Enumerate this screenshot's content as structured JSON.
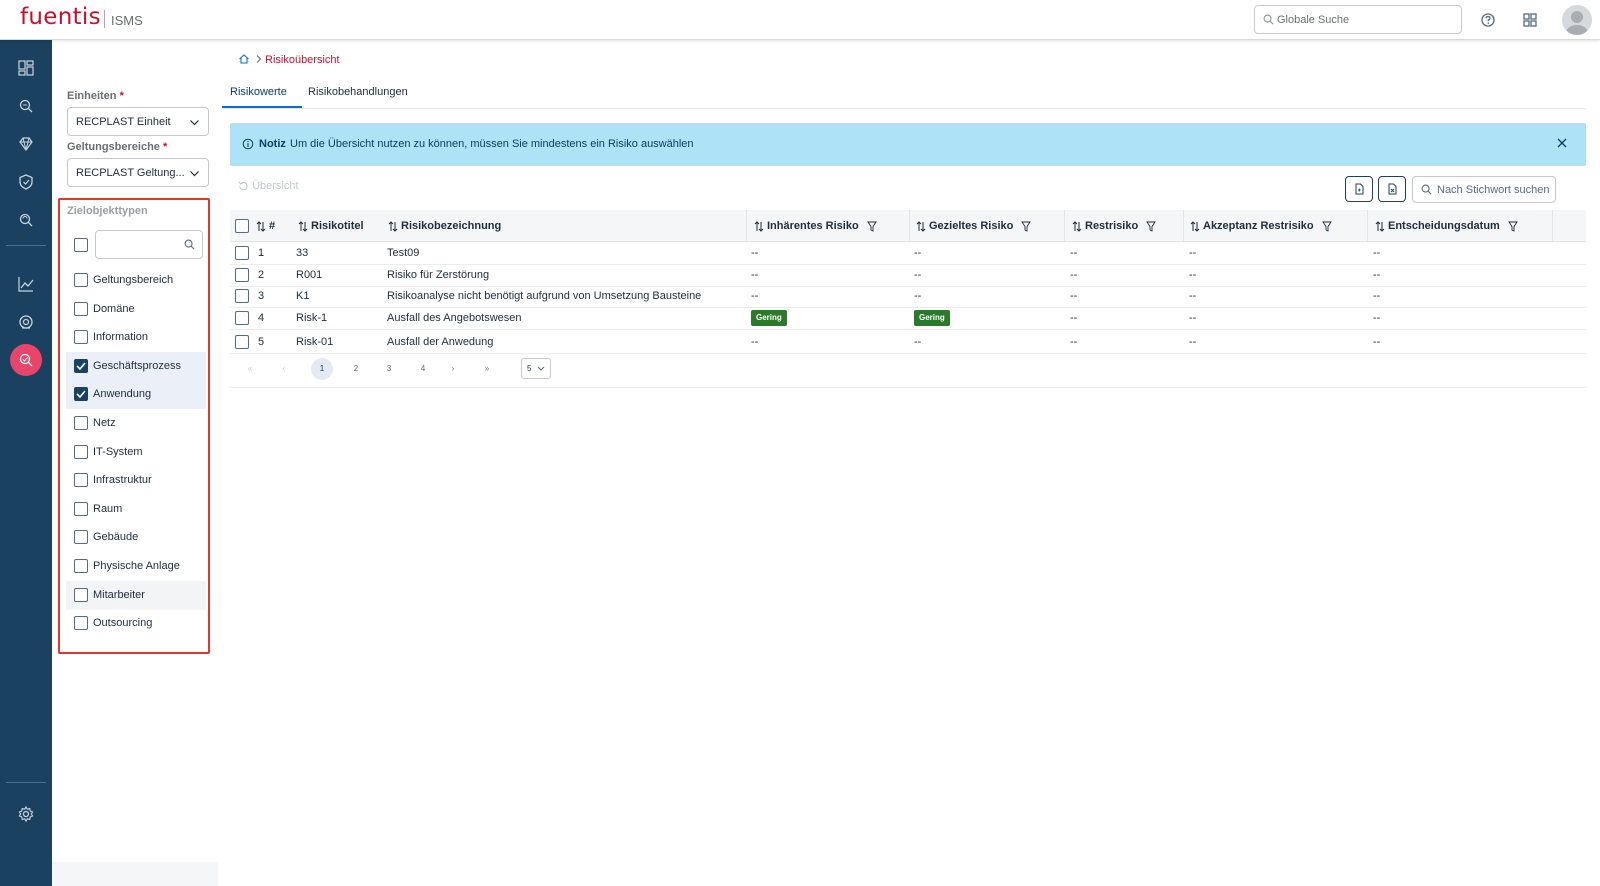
{
  "app": {
    "brand": "fuentis",
    "module": "ISMS"
  },
  "header": {
    "search_placeholder": "Globale Suche"
  },
  "nav": {
    "items": [
      "dashboard-icon",
      "search-risk-icon",
      "diamond-icon",
      "shield-icon",
      "search-refresh-icon",
      "chart-icon",
      "target-icon",
      "risk-active-icon",
      "settings-icon"
    ]
  },
  "breadcrumb": {
    "current": "Risikoübersicht"
  },
  "filters": {
    "einheiten_label": "Einheiten",
    "einheiten_value": "RECPLAST Einheit",
    "geltungsbereiche_label": "Geltungsbereiche",
    "geltungsbereiche_value": "RECPLAST Geltung...",
    "required_mark": "*",
    "zielobjekttypen_label": "Zielobjekttypen",
    "items": [
      {
        "label": "Geltungsbereich",
        "checked": false
      },
      {
        "label": "Domäne",
        "checked": false
      },
      {
        "label": "Information",
        "checked": false
      },
      {
        "label": "Geschäftsprozess",
        "checked": true
      },
      {
        "label": "Anwendung",
        "checked": true
      },
      {
        "label": "Netz",
        "checked": false
      },
      {
        "label": "IT-System",
        "checked": false
      },
      {
        "label": "Infrastruktur",
        "checked": false
      },
      {
        "label": "Raum",
        "checked": false
      },
      {
        "label": "Gebäude",
        "checked": false
      },
      {
        "label": "Physische Anlage",
        "checked": false
      },
      {
        "label": "Mitarbeiter",
        "checked": false
      },
      {
        "label": "Outsourcing",
        "checked": false
      }
    ]
  },
  "tabs": [
    {
      "label": "Risikowerte",
      "active": true
    },
    {
      "label": "Risikobehandlungen",
      "active": false
    }
  ],
  "notice": {
    "title": "Notiz",
    "text": "Um die Übersicht nutzen zu können, müssen Sie mindestens ein Risiko auswählen"
  },
  "toolbar": {
    "reset_label": "Übersicht",
    "search_placeholder": "Nach Stichwort suchen"
  },
  "table": {
    "headers": [
      "#",
      "Risikotitel",
      "Risikobezeichnung",
      "Inhärentes Risiko",
      "Gezieltes Risiko",
      "Restrisiko",
      "Akzeptanz Restrisiko",
      "Entscheidungsdatum"
    ],
    "rows": [
      {
        "num": "1",
        "titel": "33",
        "bez": "Test09",
        "inh": "--",
        "gez": "--",
        "rest": "--",
        "akz": "--",
        "datum": "--"
      },
      {
        "num": "2",
        "titel": "R001",
        "bez": "Risiko für Zerstörung",
        "inh": "--",
        "gez": "--",
        "rest": "--",
        "akz": "--",
        "datum": "--"
      },
      {
        "num": "3",
        "titel": "K1",
        "bez": "Risikoanalyse nicht benötigt aufgrund von Umsetzung Bausteine",
        "inh": "--",
        "gez": "--",
        "rest": "--",
        "akz": "--",
        "datum": "--"
      },
      {
        "num": "4",
        "titel": "Risk-1",
        "bez": "Ausfall des Angebotswesen",
        "inh": "Gering",
        "gez": "Gering",
        "rest": "--",
        "akz": "--",
        "datum": "--"
      },
      {
        "num": "5",
        "titel": "Risk-01",
        "bez": "Ausfall der Anwedung",
        "inh": "--",
        "gez": "--",
        "rest": "--",
        "akz": "--",
        "datum": "--"
      }
    ],
    "badge_color": "#2b7a2b"
  },
  "pagination": {
    "first": "«",
    "prev": "‹",
    "pages": [
      "1",
      "2",
      "3",
      "4"
    ],
    "current": "1",
    "next": "›",
    "last": "»",
    "page_size": "5"
  },
  "colors": {
    "brand": "#c8102e",
    "nav_bg": "#1b4160",
    "nav_active": "#e9446a",
    "notice_bg": "#aee3f7",
    "highlight_border": "#e0392b"
  }
}
